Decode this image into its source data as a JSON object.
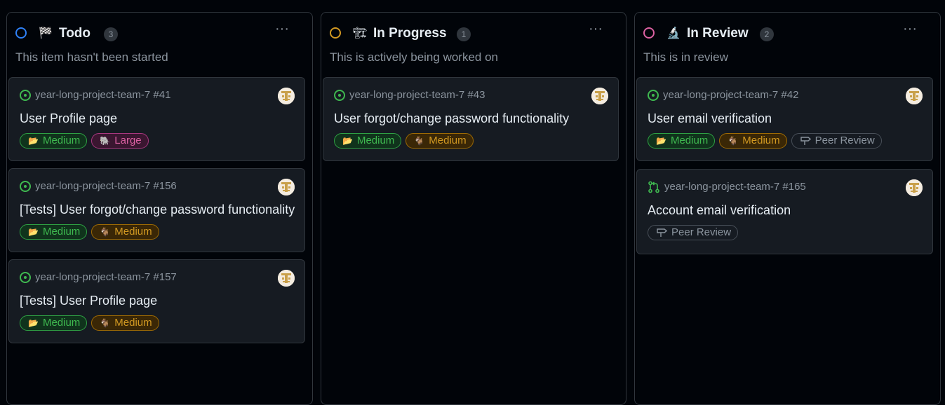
{
  "columns": [
    {
      "title": "Todo",
      "emoji": "🏁",
      "count": "3",
      "status_color": "#2f81f7",
      "description": "This item hasn't been started",
      "more": "···",
      "cards": [
        {
          "ref": "year-long-project-team-7 #41",
          "type": "issue",
          "title": "User Profile page",
          "labels": [
            {
              "emoji": "📂",
              "text": "Medium",
              "style": "green"
            },
            {
              "emoji": "🐘",
              "text": "Large",
              "style": "pink"
            }
          ]
        },
        {
          "ref": "year-long-project-team-7 #156",
          "type": "issue",
          "title": "[Tests] User forgot/change password functionality",
          "labels": [
            {
              "emoji": "📂",
              "text": "Medium",
              "style": "green"
            },
            {
              "emoji": "🐐",
              "text": "Medium",
              "style": "orange"
            }
          ]
        },
        {
          "ref": "year-long-project-team-7 #157",
          "type": "issue",
          "title": "[Tests] User Profile page",
          "labels": [
            {
              "emoji": "📂",
              "text": "Medium",
              "style": "green"
            },
            {
              "emoji": "🐐",
              "text": "Medium",
              "style": "orange"
            }
          ]
        }
      ]
    },
    {
      "title": "In Progress",
      "emoji": "🏗",
      "count": "1",
      "status_color": "#d29922",
      "description": "This is actively being worked on",
      "more": "···",
      "cards": [
        {
          "ref": "year-long-project-team-7 #43",
          "type": "issue",
          "title": "User forgot/change password functionality",
          "labels": [
            {
              "emoji": "📂",
              "text": "Medium",
              "style": "green"
            },
            {
              "emoji": "🐐",
              "text": "Medium",
              "style": "orange"
            }
          ]
        }
      ]
    },
    {
      "title": "In Review",
      "emoji": "🔬",
      "count": "2",
      "status_color": "#db61a2",
      "description": "This is in review",
      "more": "···",
      "cards": [
        {
          "ref": "year-long-project-team-7 #42",
          "type": "issue",
          "title": "User email verification",
          "labels": [
            {
              "emoji": "📂",
              "text": "Medium",
              "style": "green"
            },
            {
              "emoji": "🐐",
              "text": "Medium",
              "style": "orange"
            },
            {
              "emoji": "",
              "text": "Peer Review",
              "style": "gray"
            }
          ]
        },
        {
          "ref": "year-long-project-team-7 #165",
          "type": "pr",
          "title": "Account email verification",
          "labels": [
            {
              "emoji": "",
              "text": "Peer Review",
              "style": "gray"
            }
          ]
        }
      ]
    }
  ]
}
